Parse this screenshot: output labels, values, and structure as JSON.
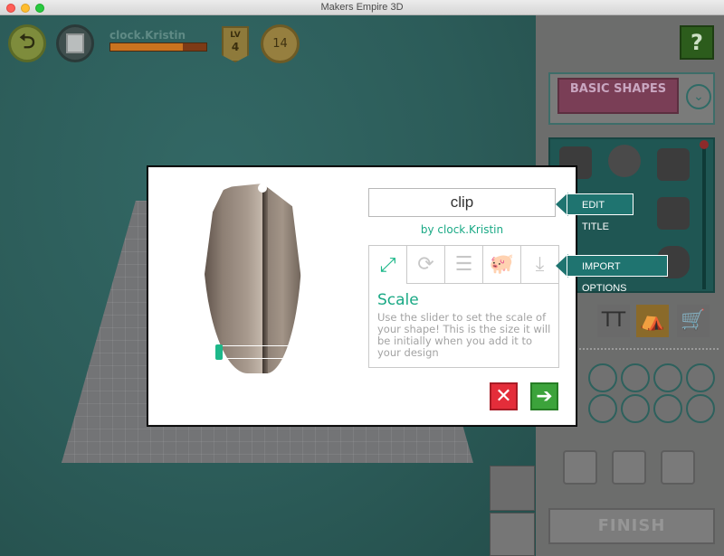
{
  "window": {
    "title": "Makers Empire 3D"
  },
  "hud": {
    "username": "clock.Kristin",
    "xp_progress": 0.75,
    "level_label": "LV",
    "level": "4",
    "coins": "14"
  },
  "right_panel": {
    "help_label": "?",
    "category_logo": "BASIC SHAPES",
    "finish_label": "FINISH"
  },
  "modal": {
    "title_value": "clip",
    "byline": "by clock.Kristin",
    "tabs": [
      {
        "name": "scale-icon",
        "active": true
      },
      {
        "name": "rotate-icon",
        "active": false
      },
      {
        "name": "comment-icon",
        "active": false
      },
      {
        "name": "piggy-bank-icon",
        "active": false
      },
      {
        "name": "import-icon",
        "active": false
      }
    ],
    "section_heading": "Scale",
    "section_description": "Use the slider to set the scale of your shape! This is the size it will be initially when you add it to your design",
    "scale_value": 0.1,
    "cancel_label": "✕",
    "next_label": "➔"
  },
  "callouts": {
    "edit_title": "EDIT TITLE",
    "import_options": "IMPORT OPTIONS"
  },
  "colors": {
    "accent": "#1aa985",
    "callout": "#1f7470",
    "cancel": "#e42d3a",
    "next": "#3ca33b"
  }
}
